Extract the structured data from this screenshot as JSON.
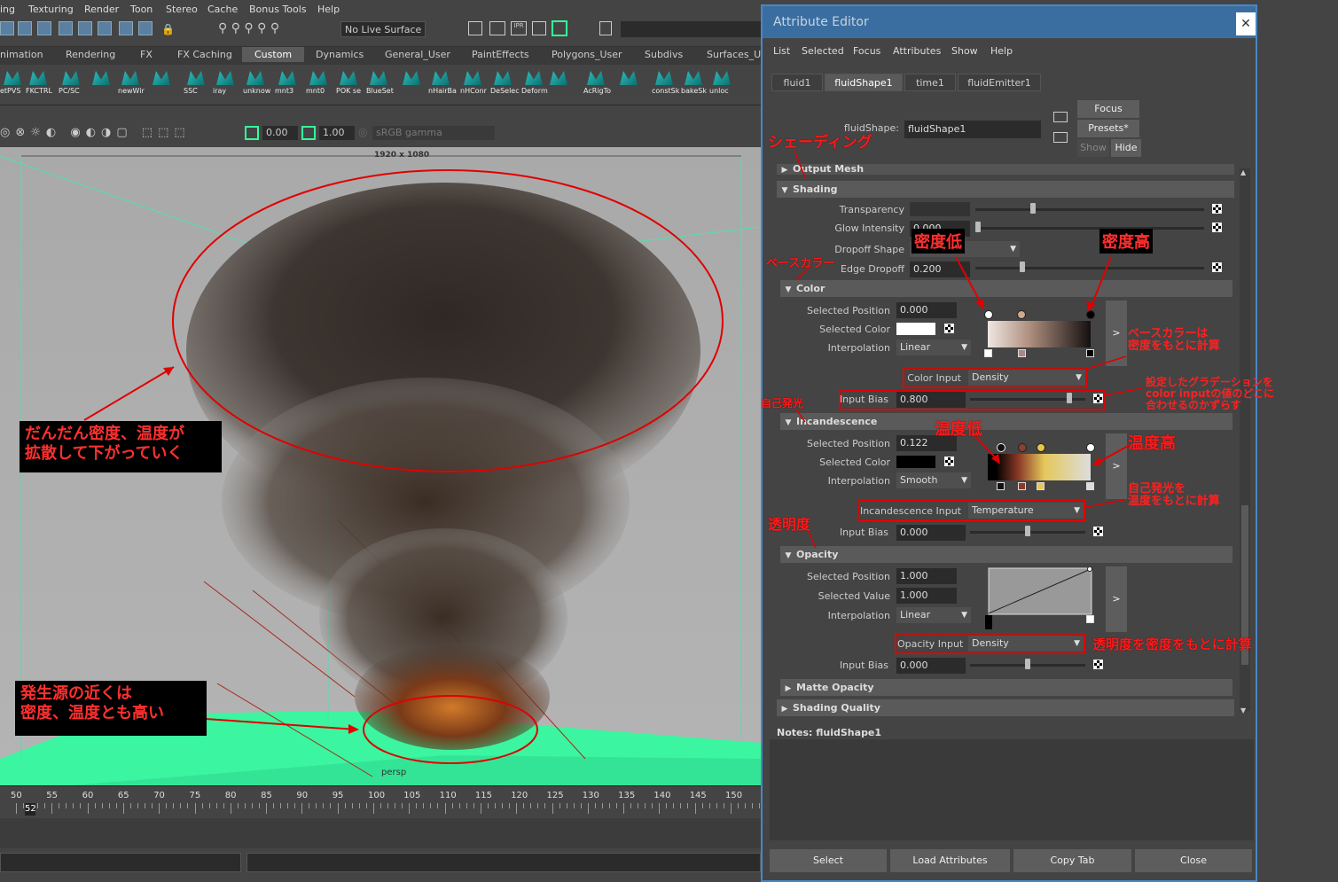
{
  "menubar": [
    "ing",
    "Texturing",
    "Render",
    "Toon",
    "Stereo",
    "Cache",
    "Bonus Tools",
    "Help"
  ],
  "toolbar": {
    "live_surface": "No Live Surface"
  },
  "shelf_tabs": [
    "nimation",
    "Rendering",
    "FX",
    "FX Caching",
    "Custom",
    "Dynamics",
    "General_User",
    "PaintEffects",
    "Polygons_User",
    "Subdivs",
    "Surfaces_Us"
  ],
  "shelf_active_tab": "Custom",
  "shelf_items": [
    "etPVS",
    "FKCTRL",
    "PC/SC",
    "",
    "newWir",
    "",
    "SSC",
    "iray",
    "unknow",
    "mnt3",
    "mnt0",
    "POK se",
    "BlueSet",
    "",
    "nHairBa",
    "nHConr",
    "DeSelec",
    "Deform",
    "",
    "AcRigTo",
    "",
    "constSk",
    "bakeSk",
    "unloc"
  ],
  "viewport": {
    "near_clip": "0.00",
    "far_clip": "1.00",
    "color_space": "sRGB gamma",
    "resolution": "1920 x 1080",
    "camera": "persp"
  },
  "timeline": {
    "ticks": [
      "50",
      "55",
      "60",
      "65",
      "70",
      "75",
      "80",
      "85",
      "90",
      "95",
      "100",
      "105",
      "110",
      "115",
      "120",
      "125",
      "130",
      "135",
      "140",
      "145",
      "150"
    ],
    "current_frame": "52"
  },
  "attribute_editor": {
    "title": "Attribute Editor",
    "menu": [
      "List",
      "Selected",
      "Focus",
      "Attributes",
      "Show",
      "Help"
    ],
    "tabs": [
      "fluid1",
      "fluidShape1",
      "time1",
      "fluidEmitter1"
    ],
    "active_tab": "fluidShape1",
    "node_label": "fluidShape:",
    "node_value": "fluidShape1",
    "focus_btn": "Focus",
    "presets_btn": "Presets*",
    "show_btn": "Show",
    "hide_btn": "Hide",
    "sections": {
      "output_mesh": "Output Mesh",
      "shading": "Shading",
      "color": "Color",
      "incandescence": "Incandescence",
      "opacity": "Opacity",
      "matte_opacity": "Matte Opacity",
      "shading_quality": "Shading Quality"
    },
    "shading": {
      "transparency_label": "Transparency",
      "glow_label": "Glow Intensity",
      "glow_value": "0.000",
      "dropoff_label": "Dropoff Shape",
      "edge_label": "Edge Dropoff",
      "edge_value": "0.200"
    },
    "color": {
      "sel_pos_label": "Selected Position",
      "sel_pos_value": "0.000",
      "sel_color_label": "Selected Color",
      "interp_label": "Interpolation",
      "interp_value": "Linear",
      "input_label": "Color Input",
      "input_value": "Density",
      "bias_label": "Input Bias",
      "bias_value": "0.800",
      "bias_fraction": 0.9
    },
    "incandescence": {
      "sel_pos_label": "Selected Position",
      "sel_pos_value": "0.122",
      "sel_color_label": "Selected Color",
      "interp_label": "Interpolation",
      "interp_value": "Smooth",
      "input_label": "Incandescence Input",
      "input_value": "Temperature",
      "bias_label": "Input Bias",
      "bias_value": "0.000"
    },
    "opacity": {
      "sel_pos_label": "Selected Position",
      "sel_pos_value": "1.000",
      "sel_val_label": "Selected Value",
      "sel_val_value": "1.000",
      "interp_label": "Interpolation",
      "interp_value": "Linear",
      "input_label": "Opacity Input",
      "input_value": "Density",
      "bias_label": "Input Bias",
      "bias_value": "0.000"
    },
    "notes_label": "Notes:  fluidShape1",
    "bottom_buttons": [
      "Select",
      "Load Attributes",
      "Copy Tab",
      "Close"
    ],
    "expand_glyph": ">"
  },
  "annotations": {
    "shading": "シェーディング",
    "base_color": "ベースカラー",
    "density_low": "密度低",
    "density_high": "密度高",
    "base_color_note": "ベースカラーは\n密度をもとに計算",
    "bias_note": "設定したグラデーションを\ncolor inputの値のどこに\n合わせるのかずらす",
    "self_glow": "自己発光",
    "temp_low": "温度低",
    "temp_high": "温度高",
    "self_glow_note": "自己発光を\n温度をもとに計算",
    "transparency": "透明度",
    "opacity_note": "透明度を密度をもとに計算",
    "smoke_note": "だんだん密度、温度が\n拡散して下がっていく",
    "source_note": "発生源の近くは\n密度、温度とも高い"
  },
  "colors": {
    "ae_border": "#4a86c5",
    "ae_title_bg": "#3b6ea0",
    "annotation_red": "#ff1a1a",
    "ground_green": "#3cf5a0"
  }
}
